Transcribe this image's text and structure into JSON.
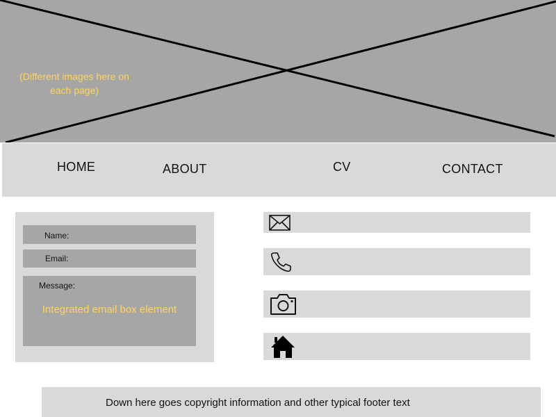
{
  "hero": {
    "note": "(Different images here on each page)"
  },
  "nav": {
    "items": [
      {
        "label": "HOME"
      },
      {
        "label": "ABOUT"
      },
      {
        "label": "CV"
      },
      {
        "label": "CONTACT"
      }
    ]
  },
  "contact_form": {
    "name_label": "Name:",
    "email_label": "Email:",
    "message_label": "Message:",
    "message_note": "Integrated email box element"
  },
  "contact_links": [
    {
      "icon": "envelope-icon"
    },
    {
      "icon": "phone-icon"
    },
    {
      "icon": "camera-icon"
    },
    {
      "icon": "home-icon"
    }
  ],
  "footer": {
    "text": "Down here goes copyright information and other typical footer text"
  },
  "colors": {
    "placeholder_gray": "#a6a6a6",
    "panel_gray": "#d9d9d9",
    "note_yellow": "#ffd45a"
  }
}
